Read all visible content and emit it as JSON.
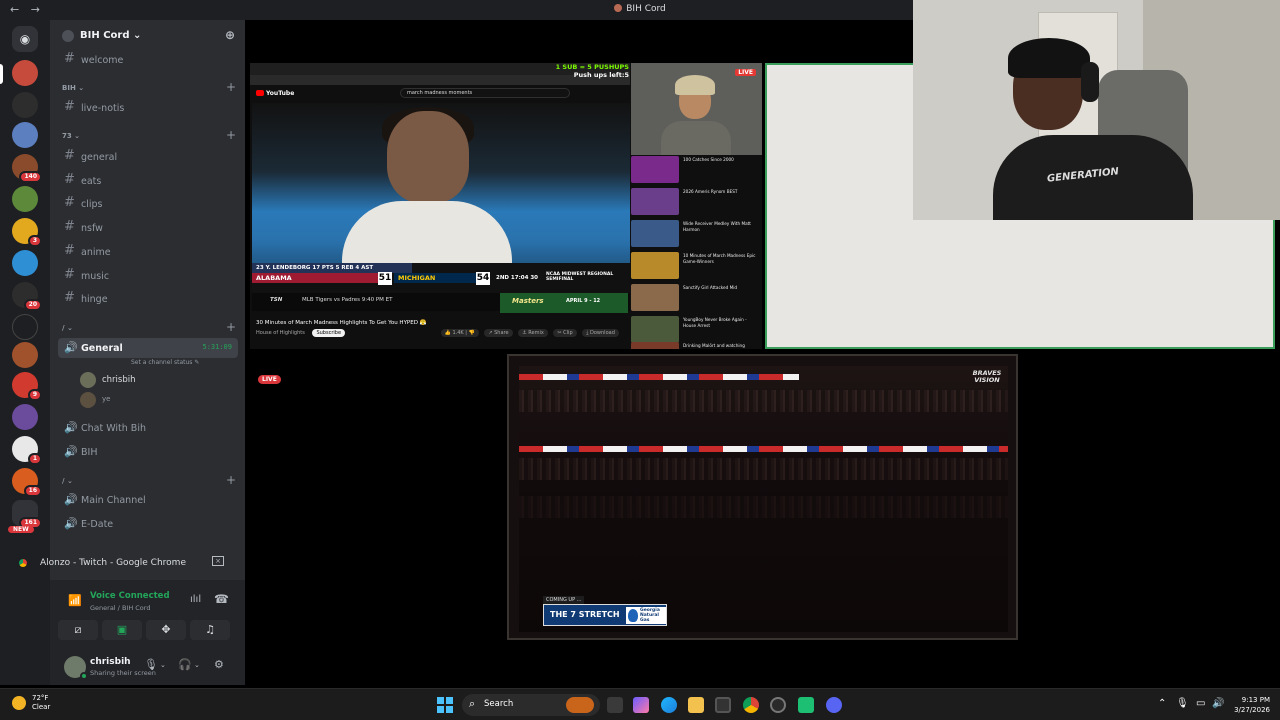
{
  "titlebar": {
    "back": "←",
    "forward": "→",
    "title": "BIH Cord"
  },
  "server": {
    "name": "BIH Cord ⌄",
    "invite_icon": "add-member-icon"
  },
  "channels": {
    "welcome": "welcome",
    "cat_bih": "BIH ⌄",
    "live_notis": "live-notis",
    "cat_73": "73 ⌄",
    "text": [
      "general",
      "eats",
      "clips",
      "nsfw",
      "anime",
      "music",
      "hinge"
    ],
    "cat_slash": "/ ⌄",
    "voice_general": "General",
    "voice_general_timer": "5:31:09",
    "set_status": "Set a channel status ✎",
    "voice_user": "chrisbih",
    "live_badge": "LIVE",
    "voice_user2": "ye",
    "chat_with_bih": "Chat With Bih",
    "bih": "BIH",
    "cat_slash2": "/ ⌄",
    "main_channel": "Main Channel",
    "e_date": "E-Date"
  },
  "guild_badges": [
    "140",
    "3",
    "20",
    "9",
    "1",
    "16",
    "161",
    "NEW"
  ],
  "stream": {
    "title": "Alonzo - Twitch - Google Chrome"
  },
  "voice": {
    "status": "Voice Connected",
    "location": "General / BIH Cord"
  },
  "user": {
    "name": "chrisbih",
    "status": "Sharing their screen"
  },
  "screen": {
    "sub_line1": "1 SUB = 5 PUSHUPS",
    "sub_line2": "Push ups left:5",
    "yt_logo": "YouTube",
    "search_query": "march madness moments",
    "score_header": "23 Y. LENDEBORG   17 PTS   5 REB   4 AST",
    "team1": "ALABAMA",
    "team1_score": "51",
    "team2": "MICHIGAN",
    "team2_score": "54",
    "clock": "2ND  17:04  30",
    "region": "NCAA MIDWEST REGIONAL SEMIFINAL",
    "ticker": "MLB  Tigers vs Padres   9:40 PM ET",
    "masters": "Masters",
    "masters_date": "APRIL 9 - 12",
    "video_title": "30 Minutes of March Madness Highlights To Get You HYPED 😤",
    "channel": "House of Highlights",
    "subscribe": "Subscribe",
    "live": "LIVE",
    "side_titles": [
      "100 Catches Since 2000",
      "2026 Ameris Rynom BEST",
      "Wide Receiver Medley With Matt Harmon",
      "10 Minutes of March Madness Epic Game-Winners",
      "Sanctify Girl Attacked Mid",
      "YoungBoy Never Broke Again - House Arrest",
      "Drinking Malört and watching"
    ]
  },
  "stadium": {
    "logo": "BRAVES VISION",
    "coming_up": "COMING UP ...",
    "stretch": "THE 7 STRETCH",
    "sponsor": "Georgia Natural Gas"
  },
  "webcam2": {
    "shirt": "GENERATION"
  },
  "taskbar": {
    "temp": "72°F",
    "condition": "Clear",
    "search": "Search",
    "time": "9:13 PM",
    "date": "3/27/2026"
  }
}
